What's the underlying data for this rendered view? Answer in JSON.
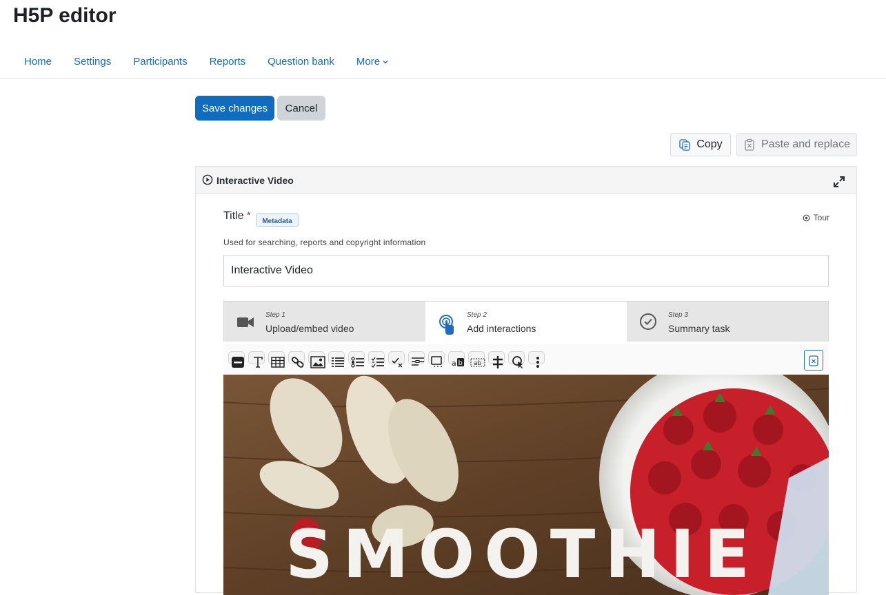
{
  "page": {
    "title": "H5P editor"
  },
  "nav": {
    "items": [
      "Home",
      "Settings",
      "Participants",
      "Reports",
      "Question bank"
    ],
    "more_label": "More"
  },
  "actions": {
    "save_label": "Save changes",
    "cancel_label": "Cancel"
  },
  "clipboard": {
    "copy_label": "Copy",
    "paste_label": "Paste and replace"
  },
  "editor": {
    "library_name": "Interactive Video",
    "title_label": "Title",
    "required_marker": "*",
    "metadata_label": "Metadata",
    "tour_label": "Tour",
    "title_description": "Used for searching, reports and copyright information",
    "title_value": "Interactive Video",
    "steps": [
      {
        "number": "Step 1",
        "label": "Upload/embed video",
        "icon": "video-camera-icon",
        "active": false
      },
      {
        "number": "Step 2",
        "label": "Add interactions",
        "icon": "touch-pointer-icon",
        "active": true
      },
      {
        "number": "Step 3",
        "label": "Summary task",
        "icon": "checkmark-circle-icon",
        "active": false
      }
    ],
    "toolbar_tools": [
      "label-icon",
      "text-icon",
      "table-icon",
      "link-icon",
      "image-icon",
      "statements-icon",
      "single-choice-icon",
      "multiple-choice-icon",
      "true-false-icon",
      "fill-in-blanks-icon",
      "drag-question-icon",
      "mark-words-icon",
      "drag-text-icon",
      "crossroads-icon",
      "navigation-hotspot-icon",
      "more-icon"
    ],
    "video_overlay_text": "SMOOTHIE"
  },
  "colors": {
    "primary": "#0f6cbf",
    "nav_link": "#0f6cbf",
    "required": "#d0021b"
  }
}
